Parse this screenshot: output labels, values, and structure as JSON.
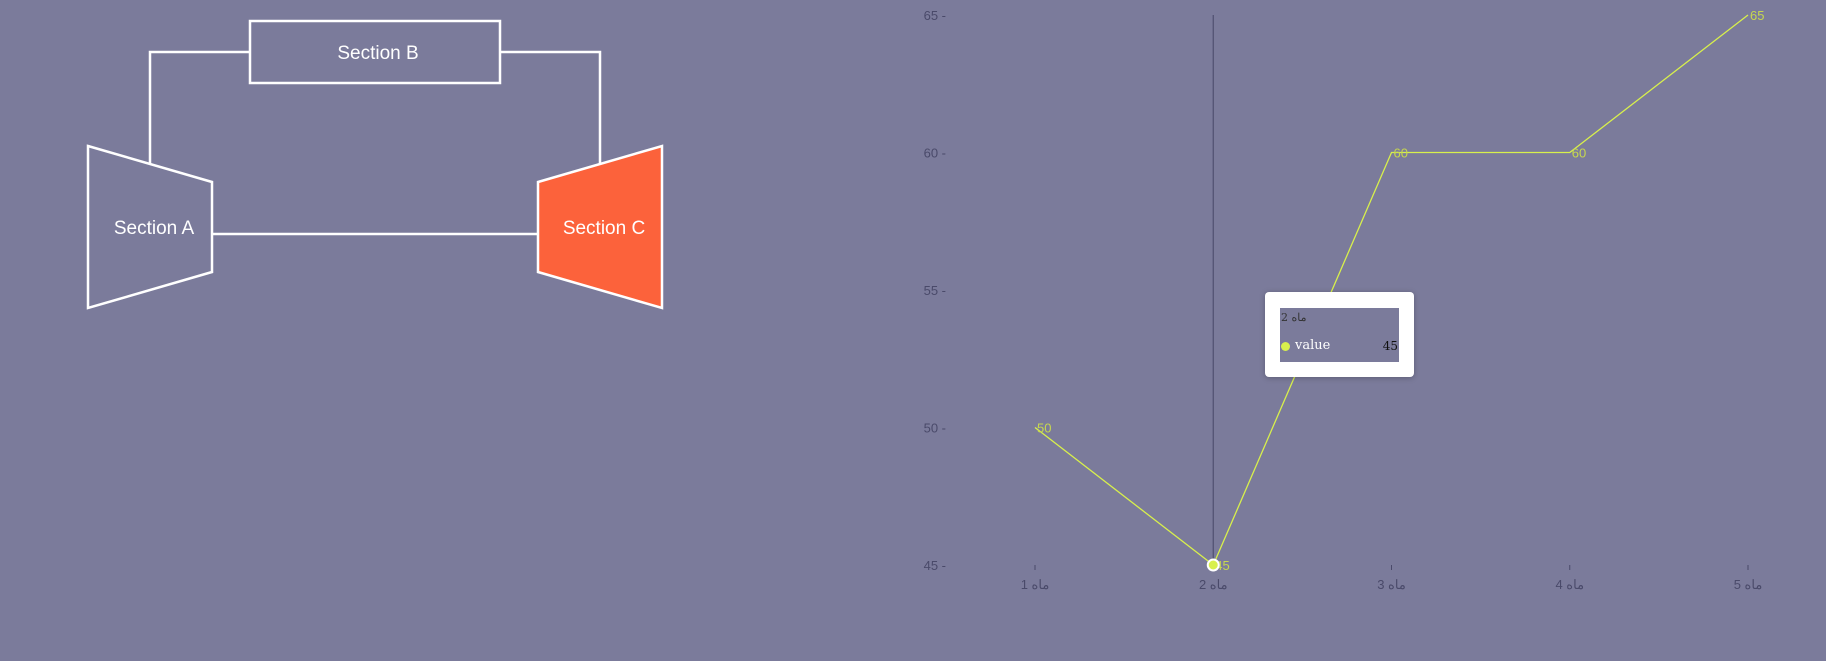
{
  "diagram": {
    "nodes": {
      "a": {
        "label": "Section A"
      },
      "b": {
        "label": "Section B"
      },
      "c": {
        "label": "Section C"
      }
    },
    "colors": {
      "stroke": "#ffffff",
      "highlight_fill": "#fc623b"
    }
  },
  "chart_data": {
    "type": "line",
    "categories": [
      "ماه 1",
      "ماه 2",
      "ماه 3",
      "ماه 4",
      "ماه 5"
    ],
    "series": [
      {
        "name": "value",
        "values": [
          50,
          45,
          60,
          60,
          65
        ]
      }
    ],
    "ylim": [
      45,
      65
    ],
    "yticks": [
      45,
      50,
      55,
      60,
      65
    ],
    "ytick_labels": [
      "45 -",
      "50 -",
      "55 -",
      "60 -",
      "65 -"
    ],
    "data_labels": [
      "50",
      "45",
      "60",
      "60",
      "65"
    ],
    "grid": false,
    "colors": {
      "line": "#d8f04c",
      "data_label": "#c7d84e",
      "axis_text": "#4a4a6a",
      "crosshair": "#4f4f6f"
    }
  },
  "tooltip": {
    "title": "ماه 2",
    "series_name": "value",
    "value": "45"
  }
}
